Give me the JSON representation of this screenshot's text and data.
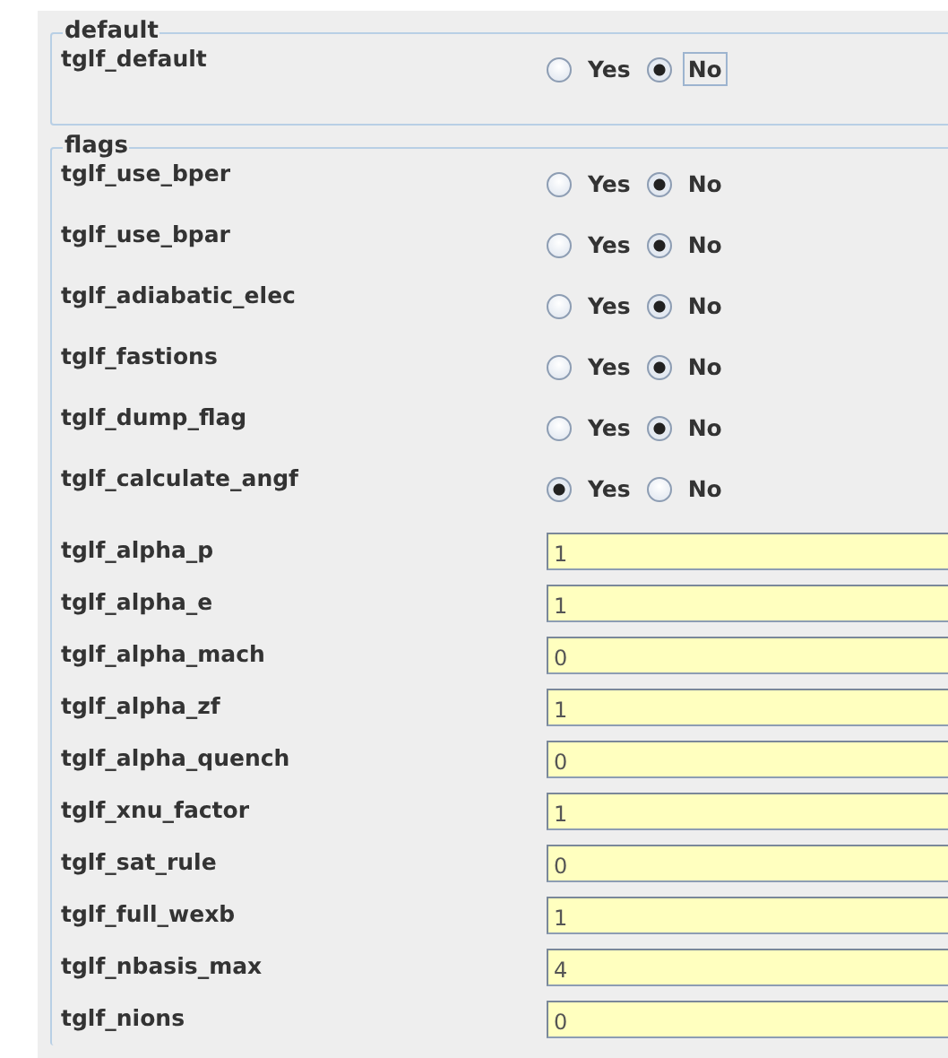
{
  "groups": [
    {
      "title": "default",
      "rows": [
        {
          "kind": "radio",
          "label": "tglf_default",
          "options": [
            {
              "label": "Yes",
              "selected": false,
              "focused": false
            },
            {
              "label": "No",
              "selected": true,
              "focused": true
            }
          ]
        }
      ]
    },
    {
      "title": "flags",
      "rows": [
        {
          "kind": "radio",
          "label": "tglf_use_bper",
          "options": [
            {
              "label": "Yes",
              "selected": false,
              "focused": false
            },
            {
              "label": "No",
              "selected": true,
              "focused": false
            }
          ]
        },
        {
          "kind": "radio",
          "label": "tglf_use_bpar",
          "options": [
            {
              "label": "Yes",
              "selected": false,
              "focused": false
            },
            {
              "label": "No",
              "selected": true,
              "focused": false
            }
          ]
        },
        {
          "kind": "radio",
          "label": "tglf_adiabatic_elec",
          "options": [
            {
              "label": "Yes",
              "selected": false,
              "focused": false
            },
            {
              "label": "No",
              "selected": true,
              "focused": false
            }
          ]
        },
        {
          "kind": "radio",
          "label": "tglf_fastions",
          "options": [
            {
              "label": "Yes",
              "selected": false,
              "focused": false
            },
            {
              "label": "No",
              "selected": true,
              "focused": false
            }
          ]
        },
        {
          "kind": "radio",
          "label": "tglf_dump_flag",
          "options": [
            {
              "label": "Yes",
              "selected": false,
              "focused": false
            },
            {
              "label": "No",
              "selected": true,
              "focused": false
            }
          ]
        },
        {
          "kind": "radio",
          "label": "tglf_calculate_angf",
          "options": [
            {
              "label": "Yes",
              "selected": true,
              "focused": false
            },
            {
              "label": "No",
              "selected": false,
              "focused": false
            }
          ]
        },
        {
          "kind": "field",
          "label": "tglf_alpha_p",
          "value": "1"
        },
        {
          "kind": "field",
          "label": "tglf_alpha_e",
          "value": "1"
        },
        {
          "kind": "field",
          "label": "tglf_alpha_mach",
          "value": "0"
        },
        {
          "kind": "field",
          "label": "tglf_alpha_zf",
          "value": "1"
        },
        {
          "kind": "field",
          "label": "tglf_alpha_quench",
          "value": "0"
        },
        {
          "kind": "field",
          "label": "tglf_xnu_factor",
          "value": "1"
        },
        {
          "kind": "field",
          "label": "tglf_sat_rule",
          "value": "0"
        },
        {
          "kind": "field",
          "label": "tglf_full_wexb",
          "value": "1"
        },
        {
          "kind": "field",
          "label": "tglf_nbasis_max",
          "value": "4"
        },
        {
          "kind": "field",
          "label": "tglf_nions",
          "value": "0"
        }
      ]
    }
  ]
}
